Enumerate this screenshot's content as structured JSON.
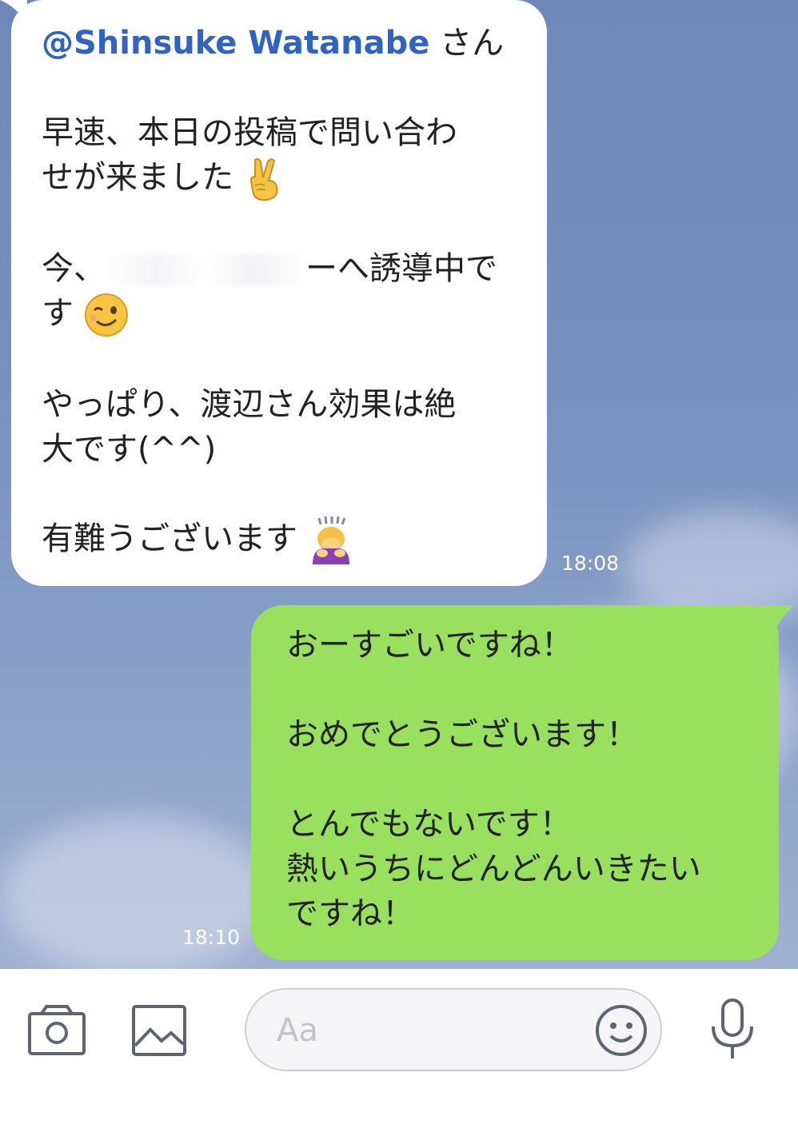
{
  "messages": {
    "incoming": {
      "mention": "@Shinsuke Watanabe",
      "honorific": " さん",
      "line1": "早速、本日の投稿で問い合わ",
      "line2": "せが来ました",
      "line3_start": "今、",
      "line3_end": "ーへ誘導中で",
      "line4": "す",
      "line5": "やっぱり、渡辺さん効果は絶",
      "line6": "大です(^^)",
      "line7": "有難うございます",
      "time": "18:08",
      "emojis": [
        "victory-hand-emoji",
        "winking-face-emoji",
        "person-bowing-emoji"
      ]
    },
    "outgoing": {
      "line1": "おーすごいですね！",
      "line2": "おめでとうございます！",
      "line3": "とんでもないです！",
      "line4": "熱いうちにどんどんいきたい",
      "line5": "ですね！",
      "time": "18:10"
    }
  },
  "input_bar": {
    "placeholder": "Aa",
    "icons": [
      "camera-icon",
      "image-icon",
      "emoji-icon",
      "microphone-icon"
    ]
  },
  "colors": {
    "chat_background": "#7890c0",
    "outgoing_bubble": "#99e05f",
    "incoming_bubble": "#ffffff",
    "mention": "#2f63c5"
  }
}
